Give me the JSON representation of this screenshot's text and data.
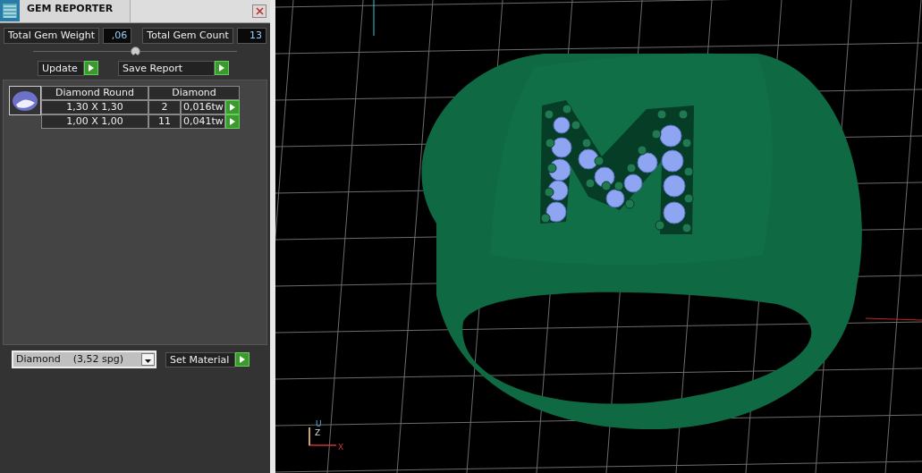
{
  "window": {
    "title": "GEM REPORTER"
  },
  "totals": [
    {
      "label": "Total Gem Weight",
      "value": ",06"
    },
    {
      "label": "Total Gem Count",
      "value": "13"
    }
  ],
  "actions": [
    "Update",
    "Save Report"
  ],
  "gem_table": {
    "columns": [
      "Diamond Round",
      "Diamond"
    ],
    "rows": [
      {
        "size": "1,30 X 1,30",
        "count": "2",
        "weight": "0,016tw"
      },
      {
        "size": "1,00 X 1,00",
        "count": "11",
        "weight": "0,041tw"
      }
    ]
  },
  "material": {
    "value": "Diamond    (3,52 spg)",
    "button": "Set Material"
  },
  "viewport": {
    "axis_labels": [
      "U",
      "Z",
      "X"
    ]
  }
}
